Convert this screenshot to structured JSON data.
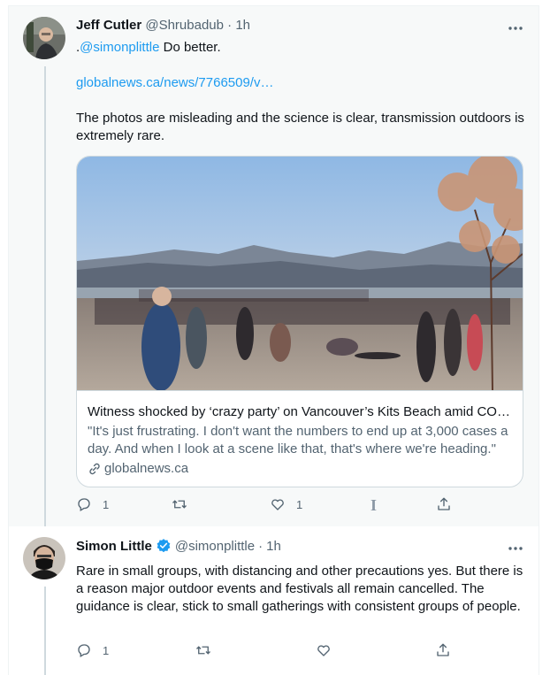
{
  "tweets": [
    {
      "name": "Jeff Cutler",
      "handle": "@Shrubadub",
      "sep": "·",
      "time": "1h",
      "more": "···",
      "text_prefix": ".",
      "mention": "@simonplittle",
      "text_main": " Do better.",
      "link": "globalnews.ca/news/7766509/v…",
      "text2": "The photos are misleading and the science is clear, transmission outdoors is extremely rare.",
      "card": {
        "title": "Witness shocked by ‘crazy party’ on Vancouver’s Kits Beach amid COVID-19 ...",
        "description": "\"It's just frustrating. I don't want the numbers to end up at 3,000 cases a day. And when I look at a scene like that, that's where we're heading.\"",
        "domain": "globalnews.ca"
      },
      "actions": {
        "replies": "1",
        "retweets": "",
        "likes": "1",
        "reader": "I"
      }
    },
    {
      "name": "Simon Little",
      "handle": "@simonplittle",
      "sep": "·",
      "time": "1h",
      "more": "···",
      "text": "Rare in small groups, with distancing and other precautions yes. But there is a reason major outdoor events and festivals all remain cancelled. The guidance is clear, stick to small gatherings with consistent groups of people.",
      "actions": {
        "replies": "1",
        "retweets": "",
        "likes": ""
      }
    }
  ],
  "colors": {
    "accent": "#1d9bf0",
    "muted": "#536471",
    "verified": "#1d9bf0",
    "highlight_bg": "#f7f9f9"
  }
}
